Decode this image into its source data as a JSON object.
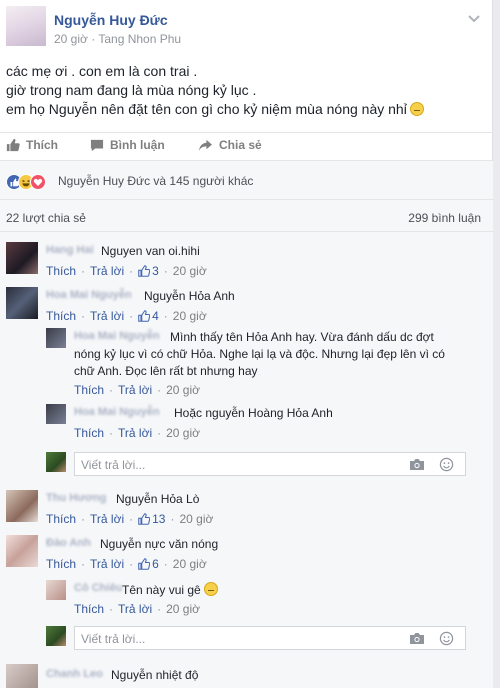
{
  "post": {
    "author": "Nguyễn Huy Đức",
    "time": "20 giờ",
    "location_prefix": "·",
    "location": "Tang Nhon Phu",
    "lines": [
      "các mẹ ơi . con em là con trai .",
      "giờ trong nam đang là mùa nóng kỷ lục .",
      "em họ Nguyễn nên đặt tên con gì cho kỷ niệm mùa nóng này nhỉ"
    ]
  },
  "actions": {
    "like": "Thích",
    "comment": "Bình luận",
    "share": "Chia sẻ"
  },
  "reactions": {
    "text": "Nguyễn Huy Đức và 145 người khác",
    "types": [
      "like-icon",
      "haha-icon",
      "love-icon"
    ],
    "colors": [
      "#4267b2",
      "#f7c843",
      "#f25268"
    ]
  },
  "stats": {
    "shares": "22 lượt chia sẻ",
    "comments": "299 bình luận"
  },
  "labels": {
    "like": "Thích",
    "reply": "Trả lời",
    "reply_placeholder": "Viết trả lời..."
  },
  "comments": [
    {
      "name": "Hang Hai",
      "text": "Nguyen van oi.hihi",
      "likes": "3",
      "time": "20 giờ"
    },
    {
      "name": "Hoa Mai Nguyễn",
      "text": "Nguyễn Hỏa Anh",
      "likes": "4",
      "time": "20 giờ",
      "replies": [
        {
          "name": "Hoa Mai Nguyễn",
          "text_lines": [
            "Mình thấy tên Hỏa Anh hay. Vừa đánh dấu dc đợt",
            "nóng kỷ lục vì có chữ Hỏa. Nghe lại lạ và độc. Nhưng lại đẹp lên vì có",
            "chữ Anh. Đọc lên rất bt nhưng hay"
          ],
          "time": "20 giờ"
        },
        {
          "name": "Hoa Mai Nguyễn",
          "text": "Hoặc nguyễn Hoàng Hỏa Anh",
          "time": "20 giờ"
        }
      ]
    },
    {
      "name": "Thu Hương",
      "text": "Nguyễn Hỏa Lò",
      "likes": "13",
      "time": "20 giờ"
    },
    {
      "name": "Đào Anh",
      "text": "Nguyễn nực văn nóng",
      "likes": "6",
      "time": "20 giờ",
      "replies": [
        {
          "name": "Cô Chiêu",
          "text": "Tên này vui gê",
          "time": "20 giờ"
        }
      ]
    },
    {
      "name": "Chanh Leo",
      "text": "Nguyễn nhiệt độ"
    }
  ]
}
